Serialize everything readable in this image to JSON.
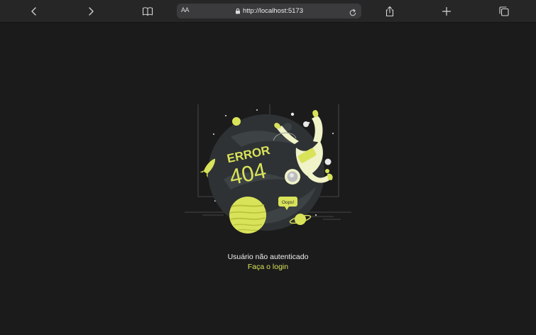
{
  "browser": {
    "address_prefix": "AA",
    "url": "http://localhost:5173",
    "icons": {
      "back": "chevron-left-icon",
      "forward": "chevron-right-icon",
      "bookmarks": "book-icon",
      "lock": "lock-icon",
      "reload": "reload-icon",
      "share": "share-icon",
      "new_tab": "plus-icon",
      "tabs": "tabs-icon"
    }
  },
  "illustration": {
    "title": "ERROR",
    "code": "404",
    "speech": "Oops!"
  },
  "message": {
    "text": "Usuário não autenticado",
    "link": "Faça o login"
  },
  "colors": {
    "accent": "#d9e35a",
    "background": "#1b1b1b",
    "toolbar": "#262626"
  }
}
